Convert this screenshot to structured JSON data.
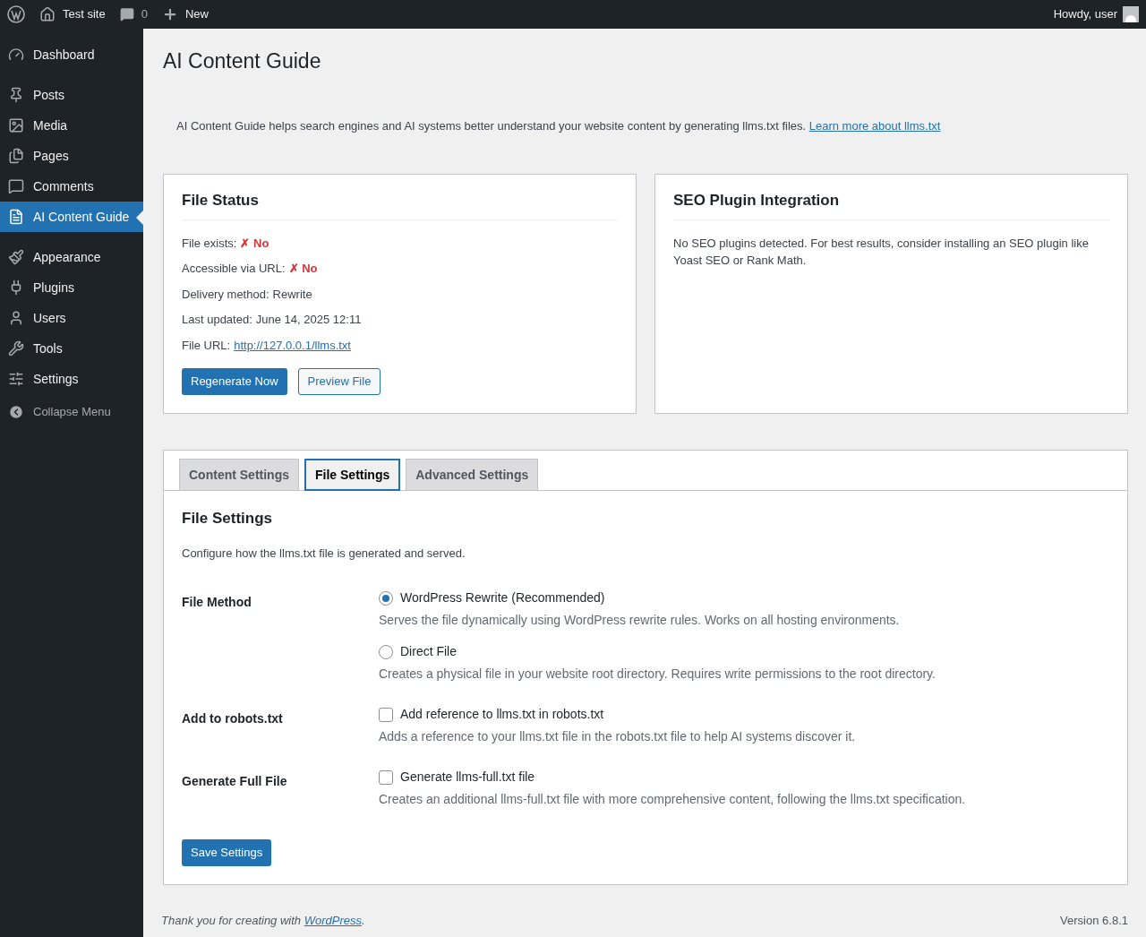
{
  "admin_bar": {
    "site": "Test site",
    "comments": "0",
    "new": "New",
    "greeting": "Howdy, user"
  },
  "sidebar": {
    "groups": [
      [
        {
          "label": "Dashboard",
          "selected": false
        }
      ],
      [
        {
          "label": "Posts",
          "selected": false
        },
        {
          "label": "Media",
          "selected": false
        },
        {
          "label": "Pages",
          "selected": false
        },
        {
          "label": "Comments",
          "selected": false
        },
        {
          "label": "AI Content Guide",
          "selected": true
        }
      ],
      [
        {
          "label": "Appearance",
          "selected": false
        },
        {
          "label": "Plugins",
          "selected": false
        },
        {
          "label": "Users",
          "selected": false
        },
        {
          "label": "Tools",
          "selected": false
        },
        {
          "label": "Settings",
          "selected": false
        }
      ]
    ],
    "collapse": "Collapse Menu"
  },
  "title": "AI Content Guide",
  "intro": {
    "text": "AI Content Guide helps search engines and AI systems better understand your website content by generating llms.txt files.",
    "link": "Learn more about llms.txt"
  },
  "file_status": {
    "title": "File Status",
    "rows": [
      {
        "label": "File exists:",
        "value": "✗ No",
        "kind": "error"
      },
      {
        "label": "Accessible via URL:",
        "value": "✗ No",
        "kind": "error"
      },
      {
        "label": "Delivery method:",
        "value": "Rewrite",
        "kind": "text"
      },
      {
        "label": "Last updated:",
        "value": "June 14, 2025 12:11",
        "kind": "text"
      },
      {
        "label": "File URL:",
        "value": "http://127.0.0.1/llms.txt",
        "kind": "link"
      }
    ],
    "buttons": [
      {
        "label": "Regenerate Now",
        "kind": "primary"
      },
      {
        "label": "Preview File",
        "kind": "secondary"
      }
    ]
  },
  "seo": {
    "title": "SEO Plugin Integration",
    "text": "No SEO plugins detected. For best results, consider installing an SEO plugin like Yoast SEO or Rank Math."
  },
  "tabs": [
    {
      "label": "Content Settings",
      "selected": false
    },
    {
      "label": "File Settings",
      "selected": true
    },
    {
      "label": "Advanced Settings",
      "selected": false
    }
  ],
  "section": {
    "title": "File Settings",
    "description": "Configure how the llms.txt file is generated and served.",
    "fields": [
      {
        "label": "File Method",
        "options": [
          {
            "kind": "radio",
            "label": "WordPress Rewrite (Recommended)",
            "description": "Serves the file dynamically using WordPress rewrite rules. Works on all hosting environments.",
            "selected": true
          },
          {
            "kind": "radio",
            "label": "Direct File",
            "description": "Creates a physical file in your website root directory. Requires write permissions to the root directory.",
            "selected": false
          }
        ]
      },
      {
        "label": "Add to robots.txt",
        "options": [
          {
            "kind": "checkbox",
            "label": "Add reference to llms.txt in robots.txt",
            "description": "Adds a reference to your llms.txt file in the robots.txt file to help AI systems discover it.",
            "checked": false
          }
        ]
      },
      {
        "label": "Generate Full File",
        "options": [
          {
            "kind": "checkbox",
            "label": "Generate llms-full.txt file",
            "description": "Creates an additional llms-full.txt file with more comprehensive content, following the llms.txt specification.",
            "checked": false
          }
        ]
      }
    ],
    "save": "Save Settings"
  },
  "footer": {
    "before": "Thank you for creating with",
    "link": "WordPress",
    "after": ".",
    "version": "Version 6.8.1"
  }
}
